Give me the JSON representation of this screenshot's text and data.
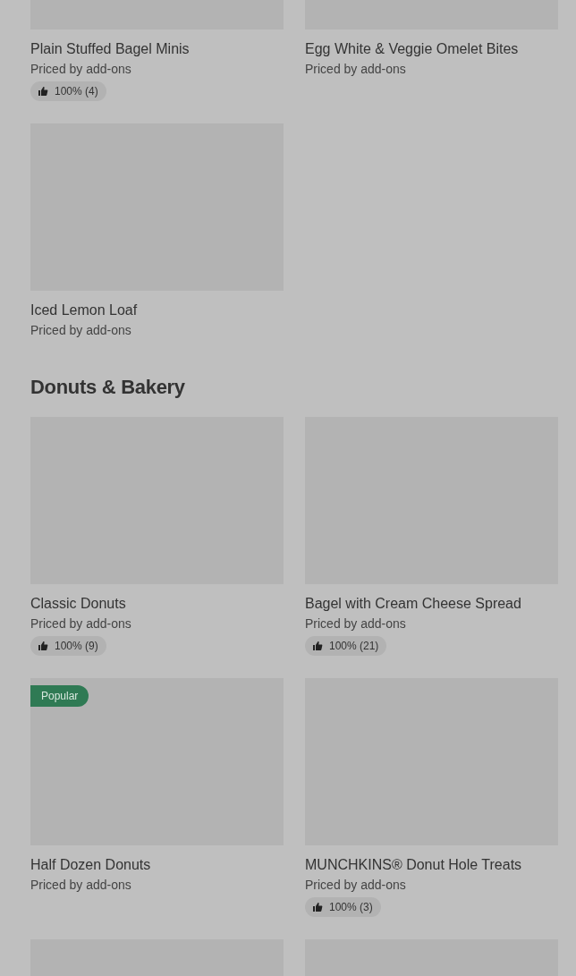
{
  "sections": [
    {
      "items": [
        {
          "kind": "item",
          "name": "Plain Stuffed Bagel Minis",
          "price": "Priced by add-ons",
          "rating": "100% (4)"
        },
        {
          "kind": "item",
          "name": "Egg White & Veggie Omelet Bites",
          "price": "Priced by add-ons"
        },
        {
          "kind": "item",
          "name": "Iced Lemon Loaf",
          "price": "Priced by add-ons"
        }
      ]
    },
    {
      "title": "Donuts & Bakery",
      "items": [
        {
          "kind": "item",
          "name": "Classic Donuts",
          "price": "Priced by add-ons",
          "rating": "100% (9)"
        },
        {
          "kind": "item",
          "name": "Bagel with Cream Cheese Spread",
          "price": "Priced by add-ons",
          "rating": "100% (21)"
        },
        {
          "kind": "item",
          "name": "Half Dozen Donuts",
          "price": "Priced by add-ons",
          "badge": "Popular"
        },
        {
          "kind": "item",
          "name": "MUNCHKINS® Donut Hole Treats",
          "price": "Priced by add-ons",
          "rating": "100% (3)"
        },
        {
          "kind": "image_only"
        },
        {
          "kind": "image_only"
        }
      ]
    }
  ]
}
